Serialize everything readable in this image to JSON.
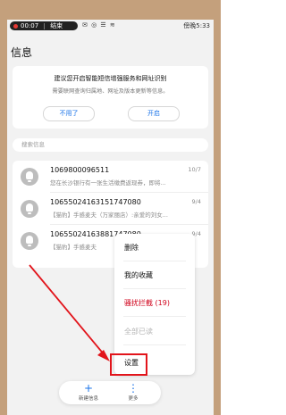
{
  "statusbar": {
    "rec_time": "00:07",
    "rec_end": "结束",
    "icons": "✉ ◎ ☰ ≋",
    "right": "傍晚5:33"
  },
  "app": {
    "title": "信息"
  },
  "promo": {
    "title": "建议您开启智能短信增强服务和网址识别",
    "desc": "需要联网查询归属地、网址及版本更新等信息。",
    "cancel_label": "不用了",
    "open_label": "开启"
  },
  "search": {
    "placeholder": "搜索信息"
  },
  "messages": [
    {
      "sender": "1069800096511",
      "date": "10/7",
      "preview": "您在长沙银行有一张生活缴费返现券，即将..."
    },
    {
      "sender": "10655024163151747080",
      "date": "9/4",
      "preview": "【猫豹】手感麦夫（万家丽店）:亲爱的刘女..."
    },
    {
      "sender": "10655024163881747080",
      "date": "9/4",
      "preview": "【猫豹】手感麦夫"
    }
  ],
  "menu": {
    "items": [
      {
        "label": "删除"
      },
      {
        "label": "我的收藏"
      },
      {
        "label": "骚扰拦截 (19)"
      },
      {
        "label": "全部已读"
      },
      {
        "label": "设置"
      }
    ]
  },
  "bottombar": {
    "new_label": "新建信息",
    "more_label": "更多",
    "new_icon": "+",
    "more_icon": "⋮"
  },
  "colors": {
    "accent": "#1a73e8",
    "annotation_red": "#e2141b",
    "phone_body": "#c4a07c"
  }
}
